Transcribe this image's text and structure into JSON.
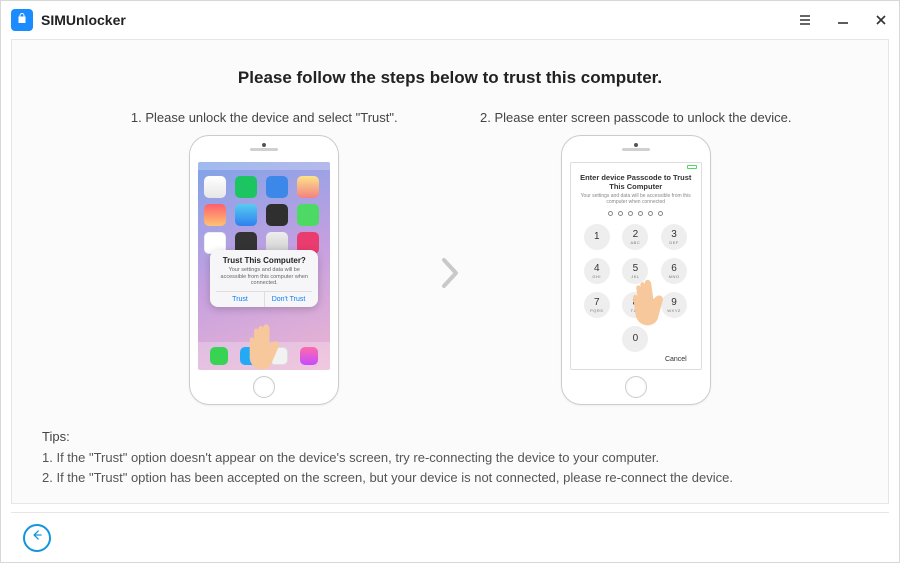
{
  "app": {
    "title": "SIMUnlocker"
  },
  "page": {
    "title": "Please follow the steps below to trust this computer.",
    "step1": "1. Please unlock the device and select \"Trust\".",
    "step2": "2. Please enter screen passcode to unlock the device."
  },
  "trust_popup": {
    "title": "Trust This Computer?",
    "body": "Your settings and data will be accessible from this computer when connected.",
    "trust": "Trust",
    "dont_trust": "Don't Trust"
  },
  "passcode": {
    "title": "Enter device Passcode to Trust This Computer",
    "subtitle": "Your settings and data will be accessible from this computer when connected",
    "keys": {
      "1": "1",
      "2": "2",
      "3": "3",
      "4": "4",
      "5": "5",
      "6": "6",
      "7": "7",
      "8": "8",
      "9": "9",
      "0": "0",
      "s2": "ABC",
      "s3": "DEF",
      "s4": "GHI",
      "s5": "JKL",
      "s6": "MNO",
      "s7": "PQRS",
      "s8": "TUV",
      "s9": "WXYZ"
    },
    "cancel": "Cancel"
  },
  "tips": {
    "label": "Tips:",
    "line1": "1. If the \"Trust\" option doesn't appear on the device's screen, try re-connecting the device to your computer.",
    "line2": "2. If the \"Trust\" option has been accepted on the screen, but your device is not connected, please re-connect the device."
  }
}
